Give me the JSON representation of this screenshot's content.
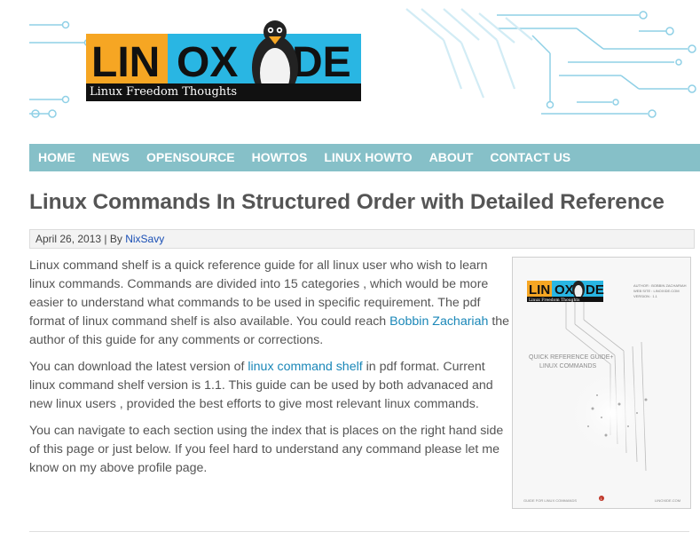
{
  "logo": {
    "brand_lin": "LIN",
    "brand_ox": "OX",
    "brand_de": "DE",
    "tagline": "Linux Freedom Thoughts"
  },
  "nav": {
    "items": [
      "HOME",
      "NEWS",
      "OPENSOURCE",
      "HOWTOS",
      "LINUX HOWTO",
      "ABOUT",
      "CONTACT US"
    ]
  },
  "article": {
    "title": "Linux Commands In Structured Order with Detailed Reference",
    "date": "April 26, 2013",
    "by": " | By ",
    "author": "NixSavy",
    "p1_a": "Linux command shelf is a quick reference guide for all linux user who wish to learn linux commands. Commands are divided into 15 categories , which would be more easier to understand what commands to be used in specific requirement. The pdf format of linux command shelf is also available. You could reach ",
    "p1_link": "Bobbin Zachariah",
    "p1_b": " the author of this guide for any comments or corrections.",
    "p2_a": "You can download the latest version of ",
    "p2_link": "linux command shelf",
    "p2_b": " in pdf format. Current linux command shelf version is 1.1. This guide can be used by both advanaced and new linux users , provided the best efforts to give most relevant linux commands.",
    "p3": "You can navigate to each section using the index that is places on the right hand side of this page or just below. If you feel hard to understand any command please let me know on my above profile page."
  },
  "cover": {
    "brand_lin": "LIN",
    "brand_ox": "OX",
    "brand_de": "DE",
    "tagline": "Linux Freedom Thoughts",
    "meta": [
      "AUTHOR : BOBBIN ZACHARIAH",
      "WEB SITE : LINOXIDE.COM",
      "VERSION : 1.1"
    ],
    "title_line1": "QUICK REFERENCE GUIDE+",
    "title_line2": "LINUX COMMANDS",
    "footer_left": "GUIDE FOR LINUX COMMANDS",
    "footer_right": "LINOXIDE.COM",
    "page_number": "1"
  },
  "colors": {
    "nav_bg": "#86c0c8",
    "logo_orange": "#f6a623",
    "logo_cyan": "#29b6e3",
    "link": "#1a87b8"
  }
}
